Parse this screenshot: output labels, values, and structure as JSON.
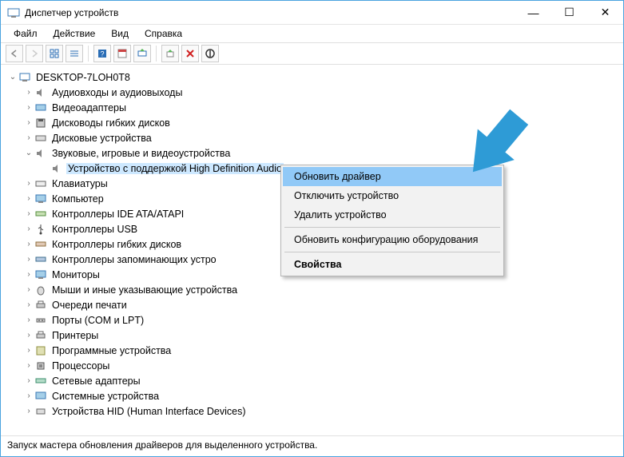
{
  "window": {
    "title": "Диспетчер устройств",
    "buttons": {
      "min": "—",
      "max": "☐",
      "close": "✕"
    }
  },
  "menu": {
    "file": "Файл",
    "action": "Действие",
    "view": "Вид",
    "help": "Справка"
  },
  "root": {
    "name": "DESKTOP-7LOH0T8"
  },
  "nodes": {
    "audio_io": "Аудиовходы и аудиовыходы",
    "video": "Видеоадаптеры",
    "floppy": "Дисководы гибких дисков",
    "disk": "Дисковые устройства",
    "sound": "Звуковые, игровые и видеоустройства",
    "hd_audio": "Устройство с поддержкой High Definition Audio",
    "keyboard": "Клавиатуры",
    "computer": "Компьютер",
    "ide": "Контроллеры IDE ATA/ATAPI",
    "usb": "Контроллеры USB",
    "floppy_ctrl": "Контроллеры гибких дисков",
    "storage_ctrl": "Контроллеры запоминающих устро",
    "monitor": "Мониторы",
    "mouse": "Мыши и иные указывающие устройства",
    "print_queue": "Очереди печати",
    "ports": "Порты (COM и LPT)",
    "printers": "Принтеры",
    "software": "Программные устройства",
    "cpu": "Процессоры",
    "network": "Сетевые адаптеры",
    "system": "Системные устройства",
    "hid": "Устройства HID (Human Interface Devices)"
  },
  "context_menu": {
    "update": "Обновить драйвер",
    "disable": "Отключить устройство",
    "uninstall": "Удалить устройство",
    "scan": "Обновить конфигурацию оборудования",
    "properties": "Свойства"
  },
  "status": "Запуск мастера обновления драйверов для выделенного устройства.",
  "colors": {
    "highlight": "#cde8ff",
    "menu_highlight": "#91c9f7",
    "arrow": "#2e9bd6"
  }
}
